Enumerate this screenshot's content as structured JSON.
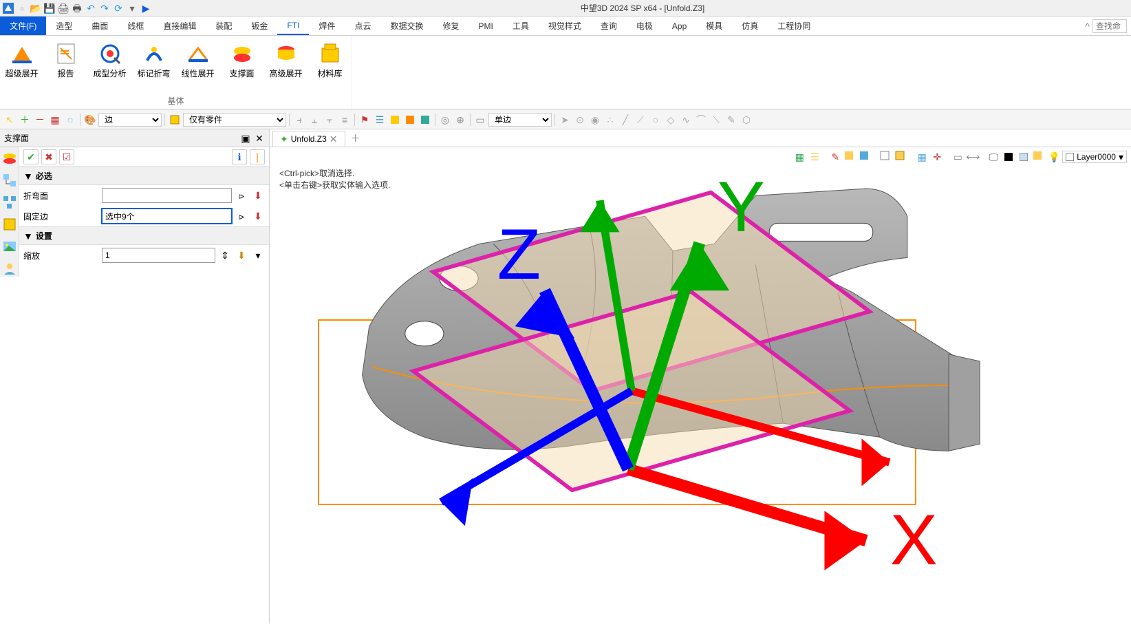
{
  "app": {
    "title": "中望3D 2024 SP x64 - [Unfold.Z3]"
  },
  "menu": {
    "file": "文件(F)",
    "tabs": [
      "造型",
      "曲面",
      "线框",
      "直接编辑",
      "装配",
      "钣金",
      "FTI",
      "焊件",
      "点云",
      "数据交换",
      "修复",
      "PMI",
      "工具",
      "视觉样式",
      "查询",
      "电极",
      "App",
      "模具",
      "仿真",
      "工程协同"
    ],
    "active_index": 6,
    "search_placeholder": "查找命"
  },
  "ribbon": {
    "group_label": "基体",
    "items": [
      {
        "label": "超级展开"
      },
      {
        "label": "报告"
      },
      {
        "label": "成型分析"
      },
      {
        "label": "标记折弯"
      },
      {
        "label": "线性展开"
      },
      {
        "label": "支撑面"
      },
      {
        "label": "高级展开"
      },
      {
        "label": "材料库"
      }
    ]
  },
  "toolbar": {
    "filter_combo": "边",
    "scope_combo": "仅有零件",
    "edge_combo": "单边"
  },
  "panel": {
    "title": "支撑面",
    "section_required": "必选",
    "section_settings": "设置",
    "rows": {
      "bend_face": {
        "label": "折弯面",
        "value": ""
      },
      "fixed_edge": {
        "label": "固定边",
        "value": "选中9个"
      },
      "scale": {
        "label": "缩放",
        "value": "1"
      }
    }
  },
  "viewport": {
    "tab_label": "Unfold.Z3",
    "hints": [
      "<Ctrl-pick>取消选择.",
      "<单击右键>获取实体输入选项."
    ],
    "layer_name": "Layer0000",
    "axis": {
      "x": "X",
      "y": "Y",
      "z": "Z"
    }
  }
}
